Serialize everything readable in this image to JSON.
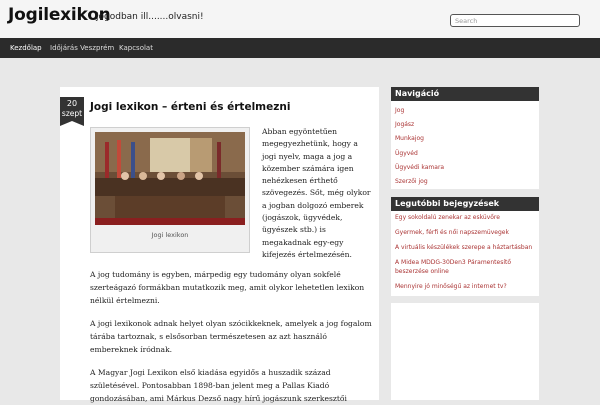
{
  "header": {
    "site_title": "Jogilexikon",
    "tagline": "jogodban ill.......olvasni!",
    "search_placeholder": "Search"
  },
  "nav": {
    "items": [
      {
        "label": "Kezdőlap",
        "active": true
      },
      {
        "label": "Időjárás Veszprém",
        "active": false
      },
      {
        "label": "Kapcsolat",
        "active": false
      }
    ]
  },
  "post": {
    "date_day": "20",
    "date_month": "szept",
    "title": "Jogi lexikon – érteni és értelmezni",
    "image_caption": "Jogi lexikon",
    "intro": "Abban egyöntetűen megegyezhetünk, hogy a jogi nyelv, maga a jog a közember számára igen nehézkesen érthető szövegezés. Sőt, még olykor a jogban dolgozó emberek (jogászok, ügyvédek, ügyészek stb.) is megakadnak egy-egy kifejezés értelmezésén.",
    "paragraphs": [
      "A jog tudomány is egyben, márpedig egy tudomány olyan sokfelé szerteágazó formákban mutatkozik meg, amit olykor lehetetlen lexikon nélkül értelmezni.",
      "A jogi lexikonok adnak helyet olyan szócikkeknek, amelyek a jog fogalom tárába tartoznak, s elsősorban természetesen az azt használó embereknek íródnak.",
      "A Magyar Jogi Lexikon első kiadása egyidős a huszadik század születésével. Pontosabban 1898-ban jelent meg a Pallas Kiadó gondozásában, ami Márkus Dezső nagy hírű jogászunk szerkesztői"
    ]
  },
  "sidebar": {
    "navigation": {
      "title": "Navigáció",
      "items": [
        "Jog",
        "Jogász",
        "Munkajog",
        "Ügyvéd",
        "Ügyvédi kamara",
        "Szerzői jog"
      ]
    },
    "recent": {
      "title": "Legutóbbi bejegyzések",
      "items": [
        "Egy sokoldalú zenekar az esküvőre",
        "Gyermek, férfi és női napszemüvegek",
        "A virtuális készülékek szerepe a háztartásban",
        "A Midea MDDG-30Den3 Páramentesítő beszerzése online",
        "Mennyire jó minőségű az internet tv?"
      ]
    }
  },
  "colors": {
    "nav_background": "#2b2b2b",
    "widget_title_background": "#333333",
    "sidebar_link": "#aa3333"
  }
}
